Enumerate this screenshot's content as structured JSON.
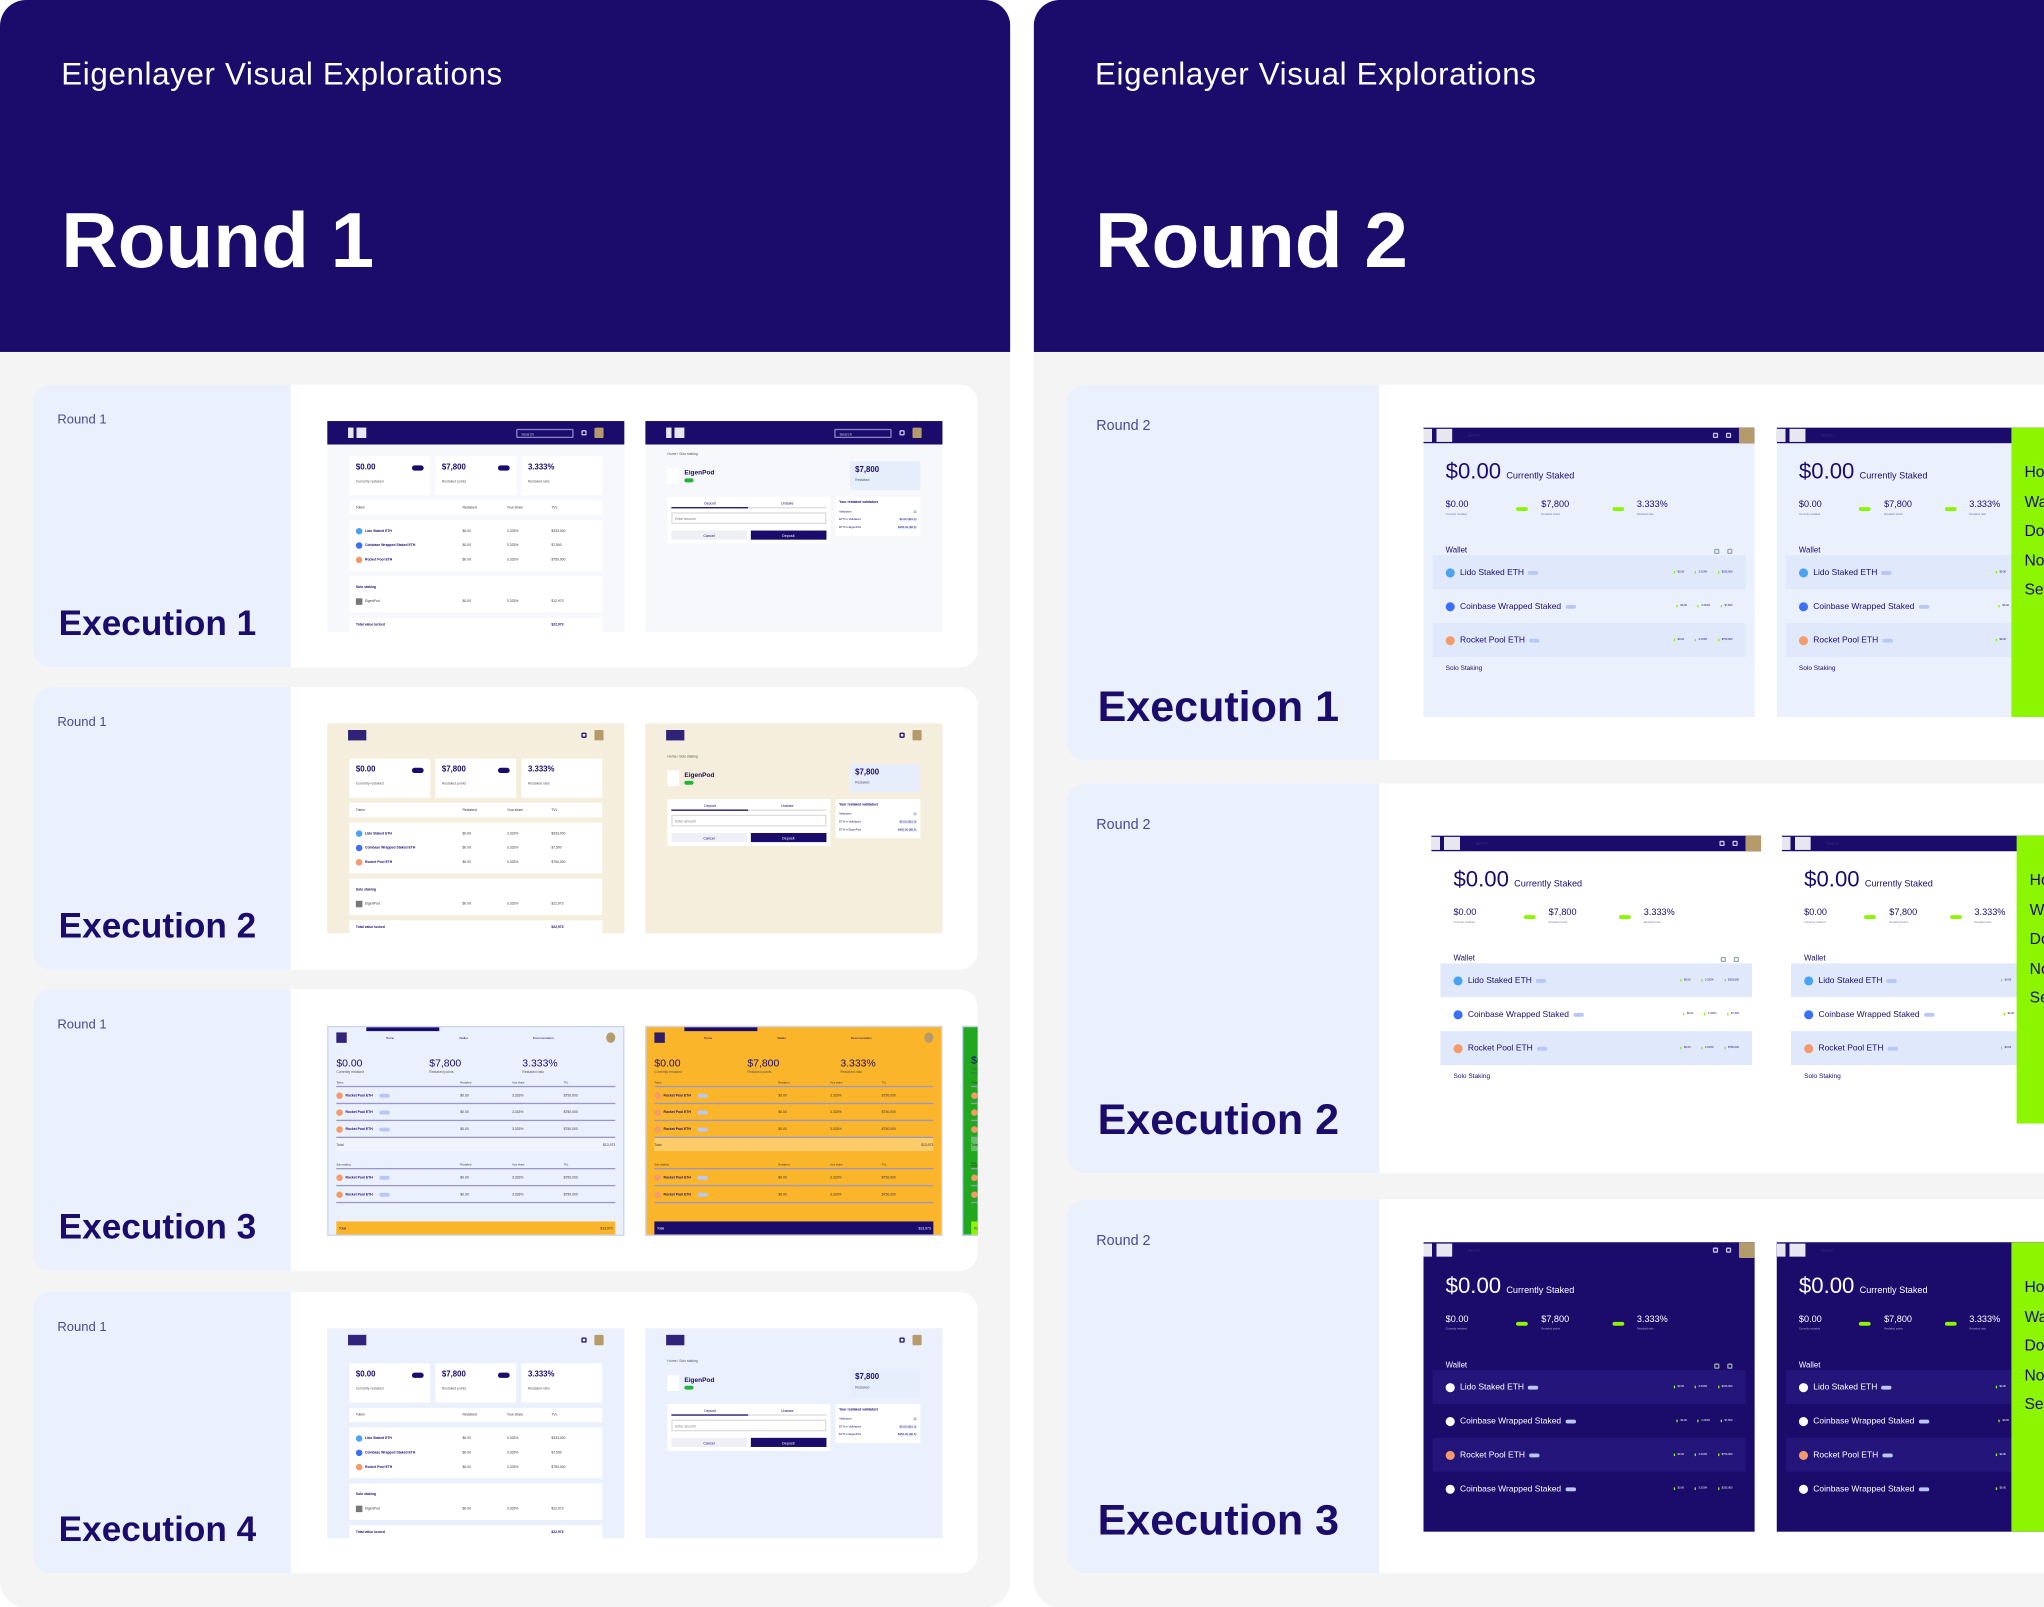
{
  "panels": [
    {
      "title": "Eigenlayer Visual Explorations",
      "round": "Round 1",
      "cards": [
        {
          "tag": "Round 1",
          "label": "Execution 1",
          "thumbs": [
            {
              "kind": "r1-dash",
              "bg": "#f7f8fb"
            },
            {
              "kind": "r1-detail",
              "bg": "#f7f8fb"
            }
          ]
        },
        {
          "tag": "Round 1",
          "label": "Execution 2",
          "thumbs": [
            {
              "kind": "r1-dash",
              "bg": "#f5eedc",
              "lightnav": true
            },
            {
              "kind": "r1-detail",
              "bg": "#f5eedc",
              "lightnav": true
            }
          ]
        },
        {
          "tag": "Round 1",
          "label": "Execution 3",
          "thumbs": [
            {
              "kind": "r1-table",
              "bg": "#eaf1fd",
              "total": "#fbb52a"
            },
            {
              "kind": "r1-table",
              "bg": "#fbb52a",
              "total": "#1b0c6c"
            },
            {
              "kind": "r1-table",
              "bg": "#22a81e",
              "total": "#8cf500"
            }
          ]
        },
        {
          "tag": "Round 1",
          "label": "Execution 4",
          "thumbs": [
            {
              "kind": "r1-dash",
              "bg": "#eaf1fd",
              "lightnav": true
            },
            {
              "kind": "r1-detail",
              "bg": "#eaf1fd",
              "lightnav": true
            }
          ]
        }
      ]
    },
    {
      "title": "Eigenlayer Visual Explorations",
      "round": "Round 2",
      "cards": [
        {
          "tag": "Round 2",
          "label": "Execution 1",
          "thumbs": [
            {
              "kind": "r2-dash",
              "bg": "#eaf1fd"
            },
            {
              "kind": "r2-menu",
              "bg": "#eaf1fd"
            }
          ]
        },
        {
          "tag": "Round 2",
          "label": "Execution 2",
          "thumbs": [
            {
              "kind": "r2-dash",
              "bg": "#ffffff"
            },
            {
              "kind": "r2-menu",
              "bg": "#ffffff"
            }
          ]
        },
        {
          "tag": "Round 2",
          "label": "Execution 3",
          "thumbs": [
            {
              "kind": "r2-dash",
              "bg": "#1b0c6c",
              "dark": true
            },
            {
              "kind": "r2-menu",
              "bg": "#1b0c6c",
              "dark": true
            }
          ]
        }
      ]
    }
  ],
  "thumb_text": {
    "search": "Search",
    "stats": [
      {
        "value": "$0.00",
        "label": "Currently restaked"
      },
      {
        "value": "$7,800",
        "label": "Restaked points"
      },
      {
        "value": "3.333%",
        "label": "Restaked ratio"
      }
    ],
    "columns": [
      "Token",
      "Restaked",
      "Your share",
      "TVL"
    ],
    "tokens": [
      {
        "name": "Lido Staked ETH",
        "restaked": "$0.00",
        "share": "3.333%",
        "tvl": "$333,000"
      },
      {
        "name": "Coinbase Wrapped Staked ETH",
        "restaked": "$0.00",
        "share": "3.333%",
        "tvl": "$7,500"
      },
      {
        "name": "Rocket Pool ETH",
        "restaked": "$0.00",
        "share": "3.333%",
        "tvl": "$750,000"
      }
    ],
    "solo": "Solo staking",
    "eigenpod": "EigenPod",
    "eigenpod_row": {
      "restaked": "$0.00",
      "share": "3.333%",
      "tvl": "$12,973"
    },
    "total_label": "Total value locked",
    "total_value": "$22,973",
    "breadcrumb": "Home / Solo staking",
    "restaked": "Restaked",
    "tabs": [
      "Deposit",
      "Unstake"
    ],
    "input_placeholder": "Enter amount",
    "cancel": "Cancel",
    "deposit": "Deposit",
    "validators_title": "Your restaked validators",
    "validator_rows": [
      {
        "label": "Validators",
        "value": "12"
      },
      {
        "label": "ETH in Validators",
        "value": "$0.00 ($10.0)"
      },
      {
        "label": "ETH in EigenPod",
        "value": "$450.00 ($0.5)"
      }
    ],
    "nav_tabs": [
      "Home",
      "Wallet",
      "Documentation"
    ],
    "r3_token": "Rocket Pool ETH",
    "r3_tvl": "$750,000",
    "total": "Total",
    "r3_total": "$13,973",
    "big_value": "$0.00",
    "currently_staked": "Currently Staked",
    "wallet": "Wallet",
    "solo_staking": "Solo Staking",
    "r2_tokens": [
      "Lido Staked ETH",
      "Coinbase Wrapped Staked",
      "Rocket Pool ETH",
      "Coinbase Wrapped Staked"
    ],
    "menu": [
      "Home",
      "Wallet",
      "Docs",
      "Notifications",
      "Settings"
    ]
  },
  "colors": {
    "navy": "#1b0c6c",
    "label_bg": "#eaf1fd",
    "lime": "#8cf500",
    "amber": "#fbb52a",
    "green_badge": "#22b33b"
  }
}
